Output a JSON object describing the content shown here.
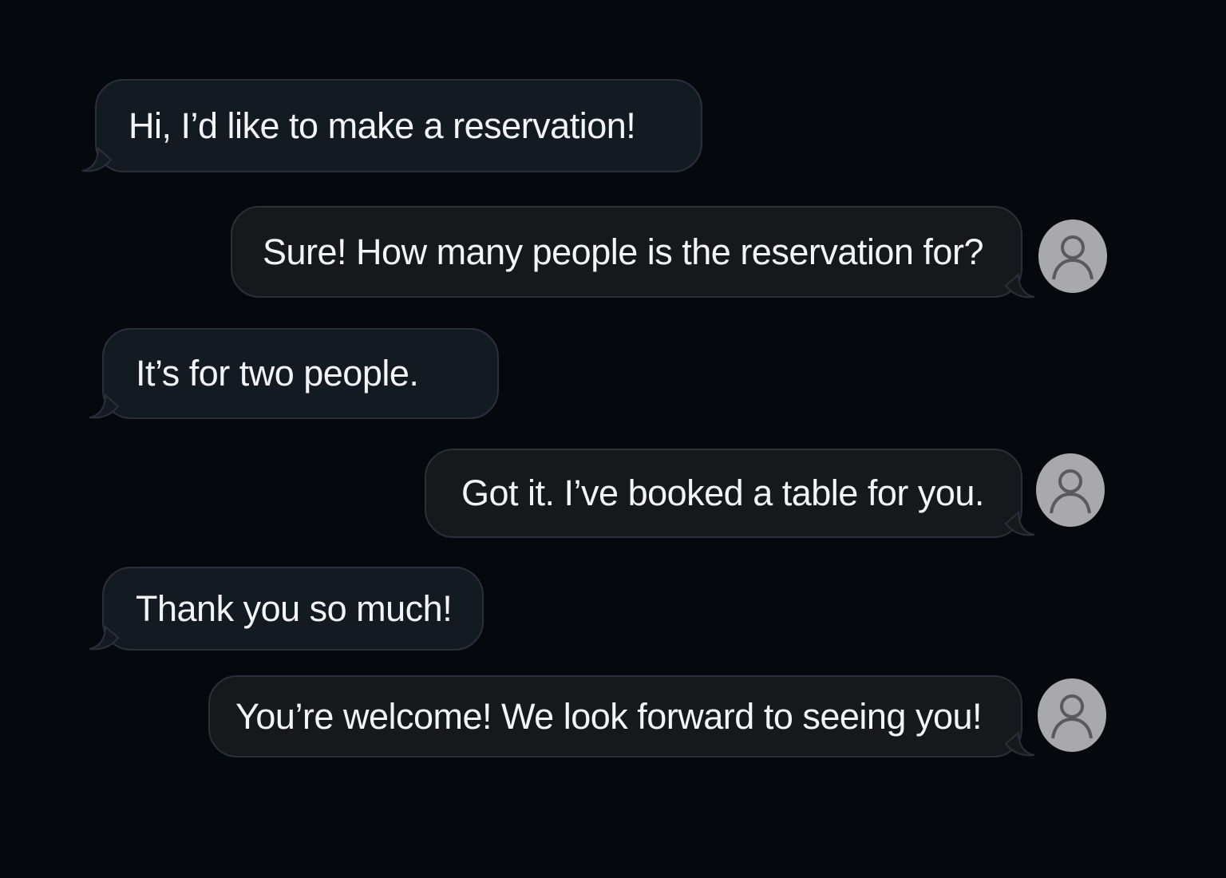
{
  "conversation": {
    "messages": [
      {
        "side": "incoming",
        "text": "Hi, I’d like to make a reservation!"
      },
      {
        "side": "outgoing",
        "text": "Sure! How many people is the reservation for?",
        "avatar": "person-icon"
      },
      {
        "side": "incoming",
        "text": "It’s for two people."
      },
      {
        "side": "outgoing",
        "text": "Got it. I’ve booked a table for you.",
        "avatar": "person-icon"
      },
      {
        "side": "incoming",
        "text": "Thank you so much!"
      },
      {
        "side": "outgoing",
        "text": "You’re welcome! We look forward to seeing you!",
        "avatar": "person-icon"
      }
    ]
  },
  "colors": {
    "background": "#05080c",
    "incoming_bubble": "#141a22",
    "outgoing_bubble": "#16181c",
    "bubble_border": "#2a3038",
    "text": "#f2f4f6",
    "avatar": "#a9a9ab"
  }
}
